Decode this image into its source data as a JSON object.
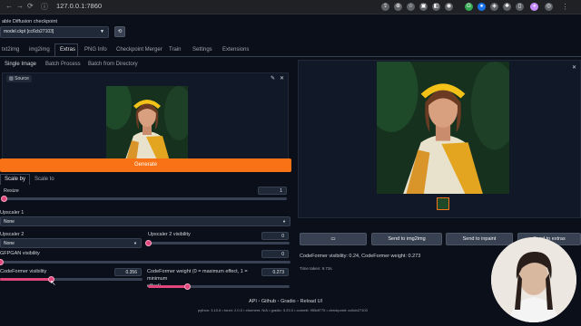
{
  "browser": {
    "url": "127.0.0.1:7860"
  },
  "checkpoint": {
    "label": "able Diffusion checkpoint",
    "value": "model.ckpt [cc6cb27103]"
  },
  "tabs": [
    "txt2img",
    "img2img",
    "Extras",
    "PNG Info",
    "Checkpoint Merger",
    "Train",
    "Settings",
    "Extensions"
  ],
  "subtabs": [
    "Single Image",
    "Batch Process",
    "Batch from Directory"
  ],
  "source": {
    "label": "Source"
  },
  "generate_label": "Generate",
  "scale_tabs": [
    "Scale by",
    "Scale to"
  ],
  "resize": {
    "label": "Resize",
    "value": "1",
    "fraction": 0.0
  },
  "upscaler1": {
    "label": "Upscaler 1",
    "value": "None"
  },
  "upscaler2": {
    "label": "Upscaler 2",
    "value": "None"
  },
  "upscaler2_vis": {
    "label": "Upscaler 2 visibility",
    "value": "0",
    "fraction": 0.0
  },
  "gfpgan": {
    "label": "GFPGAN visibility",
    "value": "0",
    "fraction": 0.0
  },
  "codeformer_vis": {
    "label": "CodeFormer visibility",
    "value": "0.356",
    "fraction": 0.356
  },
  "codeformer_weight": {
    "label": "CodeFormer weight (0 = maximum effect, 1 = minimum",
    "label2": "effect)",
    "value": "0.273",
    "fraction": 0.273
  },
  "output_buttons": {
    "folder": "▭",
    "img2img": "Send to img2img",
    "inpaint": "Send to inpaint",
    "extras": "Send to extras"
  },
  "output_info": "CodeFormer visibility: 0.24, CodeFormer weight: 0.273",
  "time_taken": "Time taken: 9.73s",
  "footer_links": [
    "API",
    "Github",
    "Gradio",
    "Reload UI"
  ],
  "footer_version": "python: 3.10.6  •  torch: 2.0.0  •  xformers: N/A  •  gradio: 3.23.0  •  commit: 955df775  •  checkpoint: cc6cb27103",
  "colors": {
    "accent": "#f97316",
    "slider": "#e0467c",
    "bg": "#0b0f19"
  }
}
